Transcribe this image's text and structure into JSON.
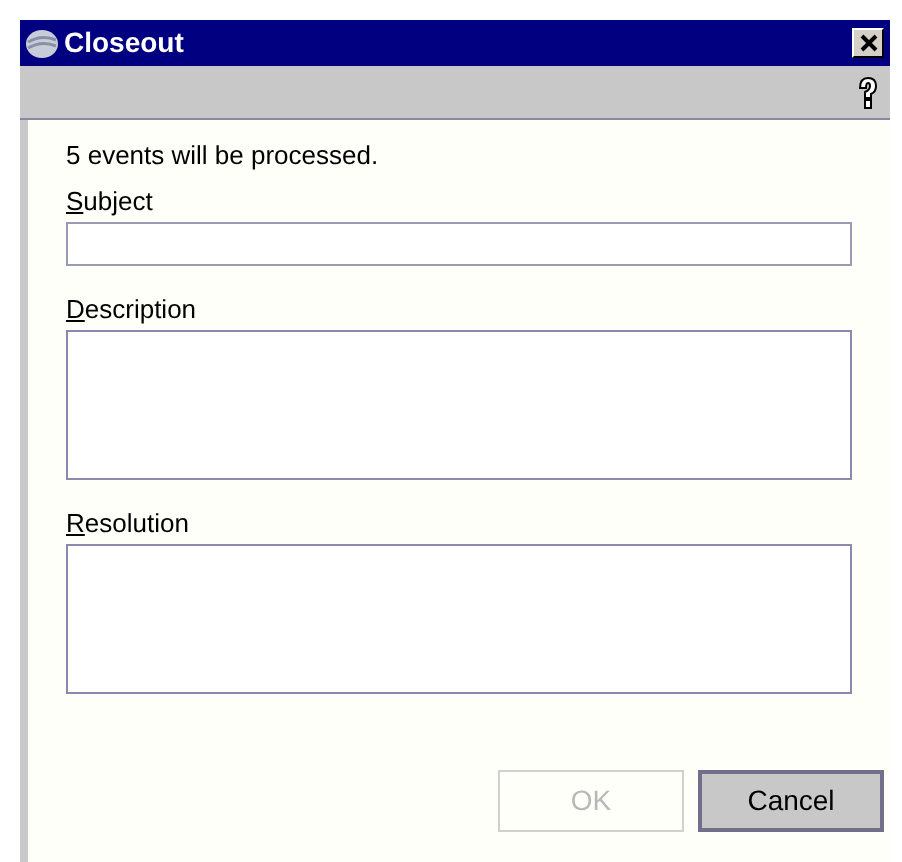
{
  "window": {
    "title": "Closeout"
  },
  "message": "5 events will be processed.",
  "fields": [
    {
      "label": "Subject",
      "kind": "line"
    },
    {
      "label": "Description",
      "kind": "area"
    },
    {
      "label": "Resolution",
      "kind": "area"
    }
  ],
  "buttons": [
    {
      "label": "OK",
      "disabled": true
    },
    {
      "label": "Cancel",
      "disabled": false
    }
  ]
}
